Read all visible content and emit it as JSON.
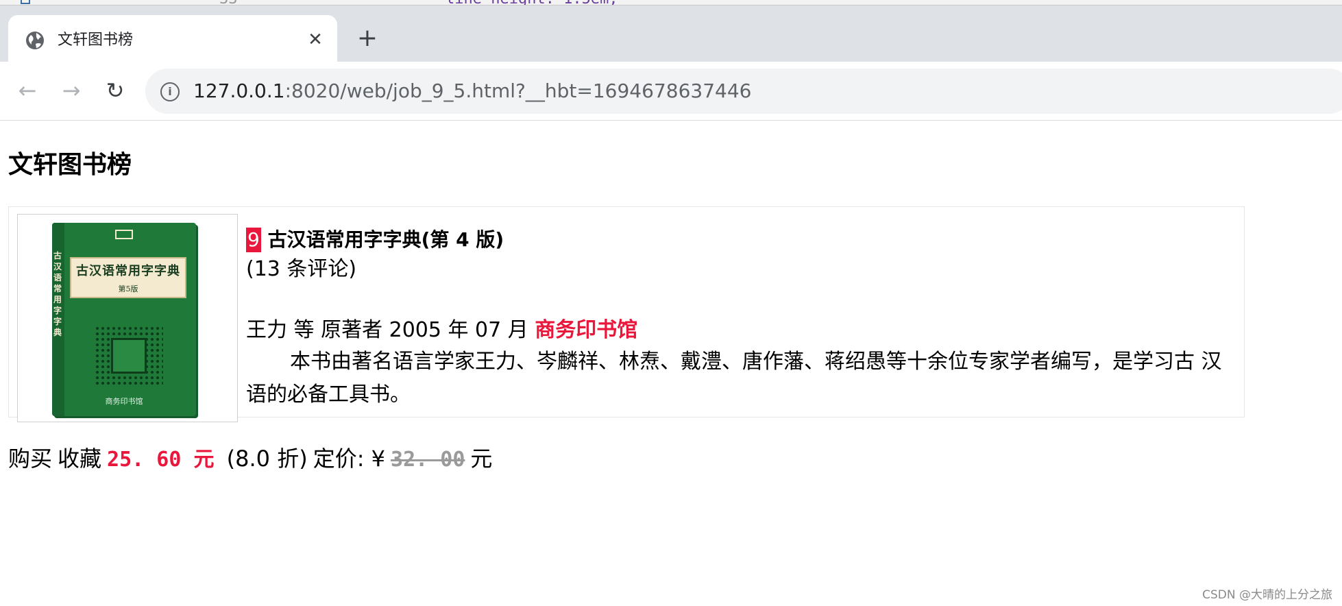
{
  "browser": {
    "tab_title": "文轩图书榜",
    "url_host": "127.0.0.1",
    "url_rest": ":8020/web/job_9_5.html?__hbt=1694678637446",
    "editor_peek_code": "line-height: 1.5em;",
    "editor_peek_linenum": "33",
    "close_glyph": "✕",
    "newtab_glyph": "+",
    "back_glyph": "←",
    "forward_glyph": "→",
    "reload_glyph": "↻",
    "info_glyph": "i"
  },
  "page": {
    "heading": "文轩图书榜",
    "book": {
      "rank": "9",
      "title": " 古汉语常用字字典(第 4 版)",
      "comments": "(13 条评论)",
      "author_date": "王力 等 原著者 2005 年 07 月 ",
      "publisher": "商务印书馆",
      "description": "本书由著名语言学家王力、岑麟祥、林焘、戴澧、唐作藩、蒋绍愚等十余位专家学者编写，是学习古 汉语的必备工具书。",
      "cover": {
        "plate_title": "古汉语常用字字典",
        "plate_edition": "第5版",
        "spine_text": "古汉语常用字字典",
        "publisher_mark": "商务印书馆"
      }
    },
    "price_row": {
      "buy": "购买",
      "favorite": "收藏",
      "sale_price": "25. 60 元",
      "discount": "(8.0 折)",
      "list_label": "定价: ¥",
      "list_price": "32. 00",
      "list_unit": "元"
    }
  },
  "watermark": "CSDN @大晴的上分之旅",
  "colors": {
    "accent_red": "#e8173b",
    "cover_green": "#1f7a3a",
    "tabstrip_bg": "#dee1e6"
  },
  "icons": [
    "globe-icon",
    "close-icon",
    "plus-icon",
    "back-arrow-icon",
    "forward-arrow-icon",
    "reload-icon",
    "info-icon"
  ]
}
